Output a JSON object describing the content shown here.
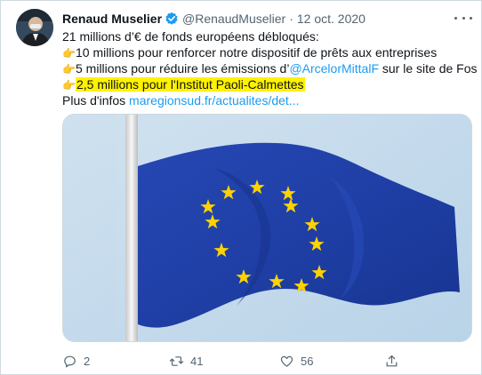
{
  "tweet": {
    "author_name": "Renaud Muselier",
    "handle": "@RenaudMuselier",
    "separator": "·",
    "date": "12 oct. 2020",
    "lines": [
      {
        "text": "21 millions d’€ de fonds européens débloqués:"
      },
      {
        "emoji": "👉",
        "text": "10 millions pour renforcer notre dispositif de prêts aux entreprises"
      },
      {
        "emoji": "👉",
        "text_before": "5 millions pour réduire les émissions d’",
        "mention": "@ArcelorMittalF",
        "text_after": " sur le site de Fos"
      },
      {
        "emoji": "👉",
        "highlighted": "2,5 millions pour l'Institut Paoli-Calmettes"
      },
      {
        "text": "Plus d'infos ",
        "link": "maregionsud.fr/actualites/det..."
      }
    ]
  },
  "actions": {
    "replies": "2",
    "retweets": "41",
    "likes": "56"
  },
  "colors": {
    "accent": "#1d9bf0",
    "highlight": "#fff200",
    "muted": "#536471",
    "flag_blue": "#1f3fa6",
    "flag_stars": "#ffd200"
  },
  "icons": {
    "verified": "verified-badge-icon",
    "more": "more-options-icon",
    "reply": "reply-icon",
    "retweet": "retweet-icon",
    "like": "like-icon",
    "share": "share-icon",
    "pointing": "pointing-right-emoji"
  }
}
